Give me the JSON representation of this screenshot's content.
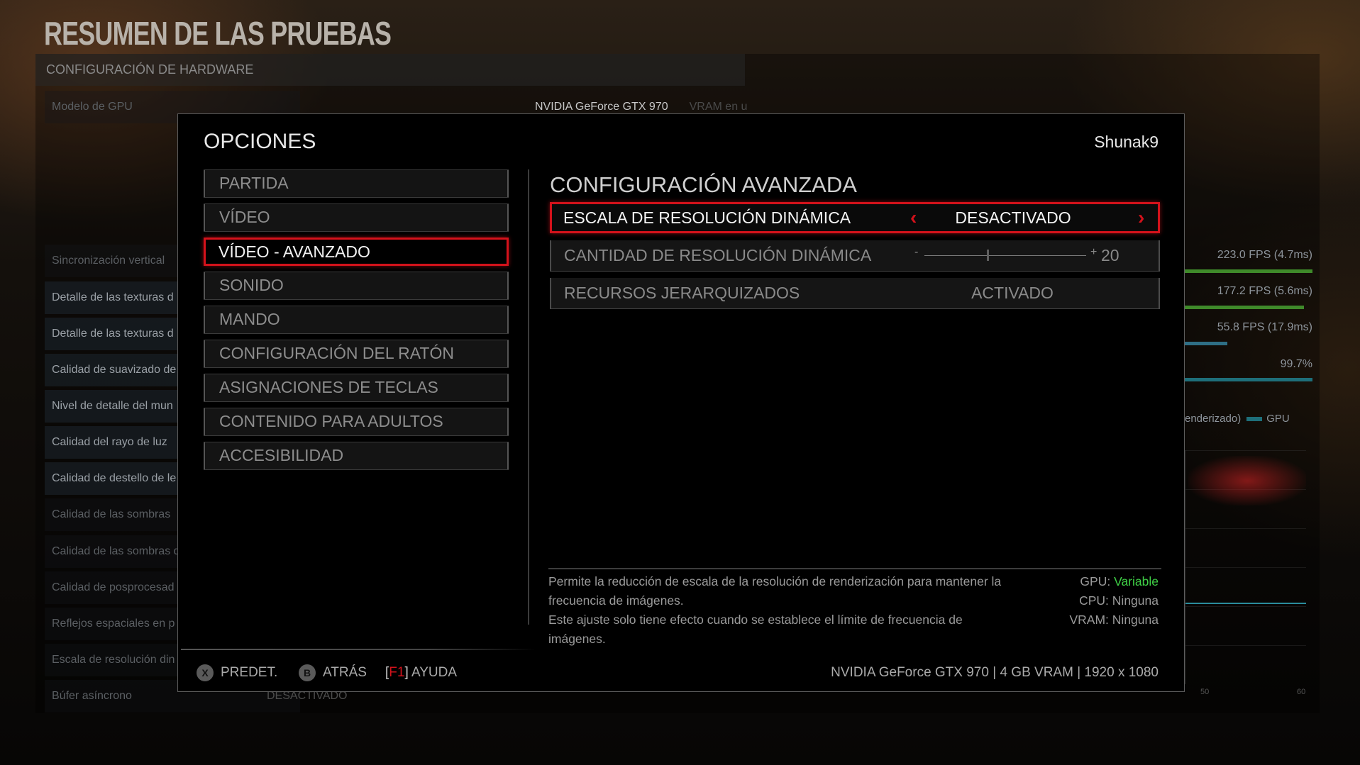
{
  "background": {
    "title": "RESUMEN DE LAS PRUEBAS",
    "hardware_header": "CONFIGURACIÓN DE HARDWARE",
    "gpu_model_label": "Modelo de GPU",
    "gpu_model_value": "NVIDIA GeForce GTX 970",
    "vram_partial": "VRAM en u",
    "rows": [
      "Sincronización vertical",
      "Detalle de las texturas d",
      "Detalle de las texturas d",
      "Calidad de suavizado de",
      "Nivel de detalle del mun",
      "Calidad del rayo de luz",
      "Calidad de destello de le",
      "Calidad de las sombras",
      "Calidad de las sombras de pantalla",
      "Calidad de posprocesad",
      "Reflejos espaciales en p",
      "Escala de resolución din",
      "Búfer asíncrono"
    ],
    "fps": [
      "223.0 FPS (4.7ms)",
      "177.2 FPS (5.6ms)",
      "55.8 FPS (17.9ms)",
      "99.7%"
    ],
    "legend": "(renderizado)",
    "legend_gpu": "GPU",
    "axis": [
      "50",
      "60"
    ],
    "desactivado": "DESACTIVADO"
  },
  "dialog": {
    "title": "OPCIONES",
    "user": "Shunak9",
    "menu": [
      {
        "label": "PARTIDA",
        "active": false
      },
      {
        "label": "VÍDEO",
        "active": false
      },
      {
        "label": "VÍDEO - AVANZADO",
        "active": true
      },
      {
        "label": "SONIDO",
        "active": false
      },
      {
        "label": "MANDO",
        "active": false
      },
      {
        "label": "CONFIGURACIÓN DEL RATÓN",
        "active": false
      },
      {
        "label": "ASIGNACIONES DE TECLAS",
        "active": false
      },
      {
        "label": "CONTENIDO PARA ADULTOS",
        "active": false
      },
      {
        "label": "ACCESIBILIDAD",
        "active": false
      }
    ],
    "section_title": "CONFIGURACIÓN AVANZADA",
    "settings": {
      "dynamic_resolution_scale": {
        "label": "ESCALA DE RESOLUCIÓN DINÁMICA",
        "value": "DESACTIVADO"
      },
      "dynamic_resolution_amount": {
        "label": "CANTIDAD DE RESOLUCIÓN DINÁMICA",
        "min_symbol": "-",
        "max_symbol": "+",
        "value": "20",
        "level_fraction": 0.39
      },
      "tiled_resources": {
        "label": "RECURSOS JERARQUIZADOS",
        "value": "ACTIVADO"
      }
    },
    "description": [
      "Permite la reducción de escala de la resolución de renderización para mantener la",
      "frecuencia de imágenes.",
      "Este ajuste solo tiene efecto cuando se establece el límite de frecuencia de",
      "imágenes."
    ],
    "impact": {
      "gpu_label": "GPU:",
      "gpu_value": "Variable",
      "cpu_label": "CPU:",
      "cpu_value": "Ninguna",
      "vram_label": "VRAM:",
      "vram_value": "Ninguna"
    },
    "footer": {
      "default_key": "X",
      "default_label": "PREDET.",
      "back_key": "B",
      "back_label": "ATRÁS",
      "help_key": "F1",
      "help_label": "AYUDA",
      "system_info": "NVIDIA GeForce GTX 970 | 4 GB VRAM | 1920 x 1080"
    }
  },
  "colors": {
    "accent_red": "#d4121b",
    "positive_green": "#3fd046"
  }
}
